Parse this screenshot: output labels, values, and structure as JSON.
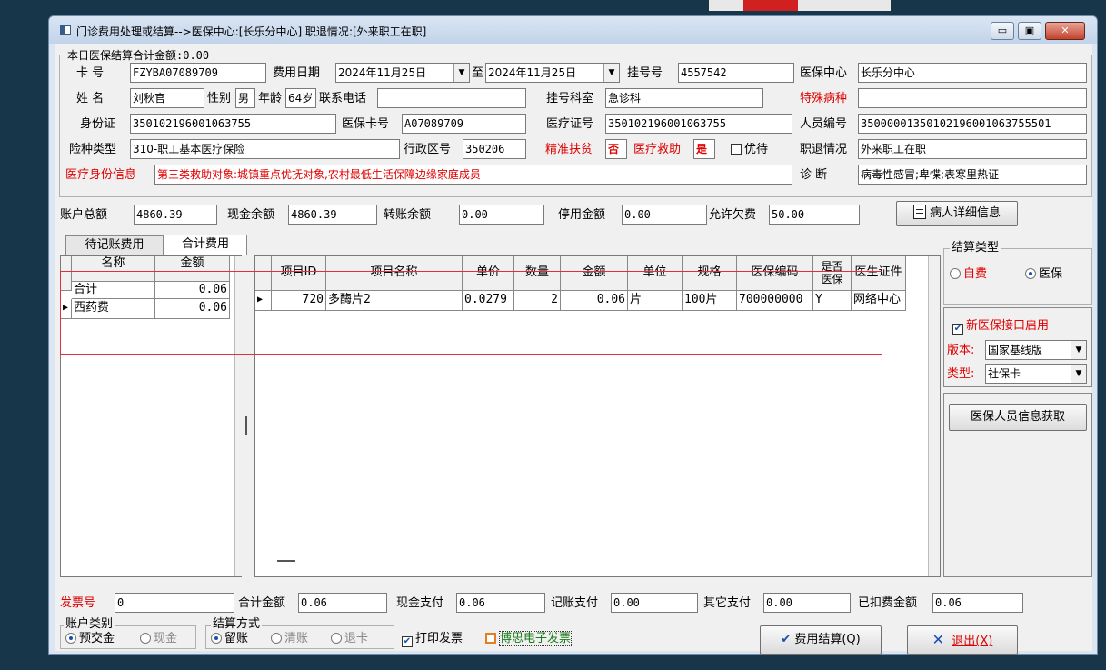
{
  "window": {
    "title": "门诊费用处理或结算-->医保中心:[长乐分中心] 职退情况:[外来职工在职]",
    "min": "▭",
    "max": "▣",
    "close": "✕"
  },
  "summary": {
    "group_title": "本日医保结算合计金额:0.00"
  },
  "patient": {
    "card_label": "卡  号",
    "card": "FZYBA07089709",
    "fee_date_label": "费用日期",
    "date_from": "2024年11月25日",
    "to_label": "至",
    "date_to": "2024年11月25日",
    "reg_label": "挂号号",
    "reg_no": "4557542",
    "center_label": "医保中心",
    "center": "长乐分中心",
    "name_label": "姓  名",
    "name": "刘秋官",
    "sex_label": "性别",
    "sex": "男",
    "age_label": "年龄",
    "age": "64岁",
    "phone_label": "联系电话",
    "phone": "",
    "dept_label": "挂号科室",
    "dept": "急诊科",
    "special_label": "特殊病种",
    "special": "",
    "id_label": "身份证",
    "id": "350102196001063755",
    "ins_card_label": "医保卡号",
    "ins_card": "A07089709",
    "med_cert_label": "医疗证号",
    "med_cert": "350102196001063755",
    "person_no_label": "人员编号",
    "person_no": "35000001350102196001063755501",
    "ins_type_label": "险种类型",
    "ins_type": "310-职工基本医疗保险",
    "region_label": "行政区号",
    "region": "350206",
    "poverty_label": "精准扶贫",
    "poverty": "否",
    "aid_label": "医疗救助",
    "aid": "是",
    "priority_label": "优待",
    "retire_label": "职退情况",
    "retire": "外来职工在职",
    "identity_label": "医疗身份信息",
    "identity": "第三类救助对象:城镇重点优抚对象,农村最低生活保障边缘家庭成员",
    "diag_label": "诊    断",
    "diag": "病毒性感冒;卑惵;表寒里热证"
  },
  "account": {
    "total_label": "账户总额",
    "total": "4860.39",
    "cash_label": "现金余额",
    "cash": "4860.39",
    "transfer_label": "转账余额",
    "transfer": "0.00",
    "stop_label": "停用金额",
    "stop": "0.00",
    "arrears_label": "允许欠费",
    "arrears": "50.00",
    "detail_btn": "病人详细信息"
  },
  "tabs": [
    "待记账费用",
    "合计费用"
  ],
  "left_grid": {
    "headers": [
      "名称",
      "金额"
    ],
    "rows": [
      [
        "合计",
        "0.06"
      ],
      [
        "西药费",
        "0.06"
      ]
    ]
  },
  "main_grid": {
    "headers": [
      "项目ID",
      "项目名称",
      "单价",
      "数量",
      "金额",
      "单位",
      "规格",
      "医保编码",
      "是否医保",
      "医生证件"
    ],
    "rows": [
      [
        "720",
        "多酶片2",
        "0.0279",
        "2",
        "0.06",
        "片",
        "100片",
        "700000000",
        "Y",
        "网络中心"
      ]
    ]
  },
  "settle_type": {
    "title": "结算类型",
    "self_pay": "自费",
    "insurance": "医保",
    "selected": "医保"
  },
  "interface": {
    "enabled_label": "新医保接口启用",
    "version_label": "版本:",
    "version": "国家基线版",
    "type_label": "类型:",
    "type": "社保卡",
    "fetch_btn": "医保人员信息获取"
  },
  "footer": {
    "invoice_label": "发票号",
    "invoice": "0",
    "sum_label": "合计金额",
    "sum": "0.06",
    "cash_pay_label": "现金支付",
    "cash_pay": "0.06",
    "account_pay_label": "记账支付",
    "account_pay": "0.00",
    "other_pay_label": "其它支付",
    "other_pay": "0.00",
    "deducted_label": "已扣费金额",
    "deducted": "0.06",
    "acct_type_title": "账户类别",
    "prepay": "预交金",
    "cash": "现金",
    "method_title": "结算方式",
    "keep": "留账",
    "clear": "清账",
    "refund": "退卡",
    "print_invoice": "打印发票",
    "e_invoice": "博思电子发票",
    "settle_btn": "费用结算(Q)",
    "exit_btn": "退出(X)"
  },
  "colors": {
    "accent_red": "#e00000",
    "window_bg": "#dbe6f2",
    "background": "#17364a"
  }
}
